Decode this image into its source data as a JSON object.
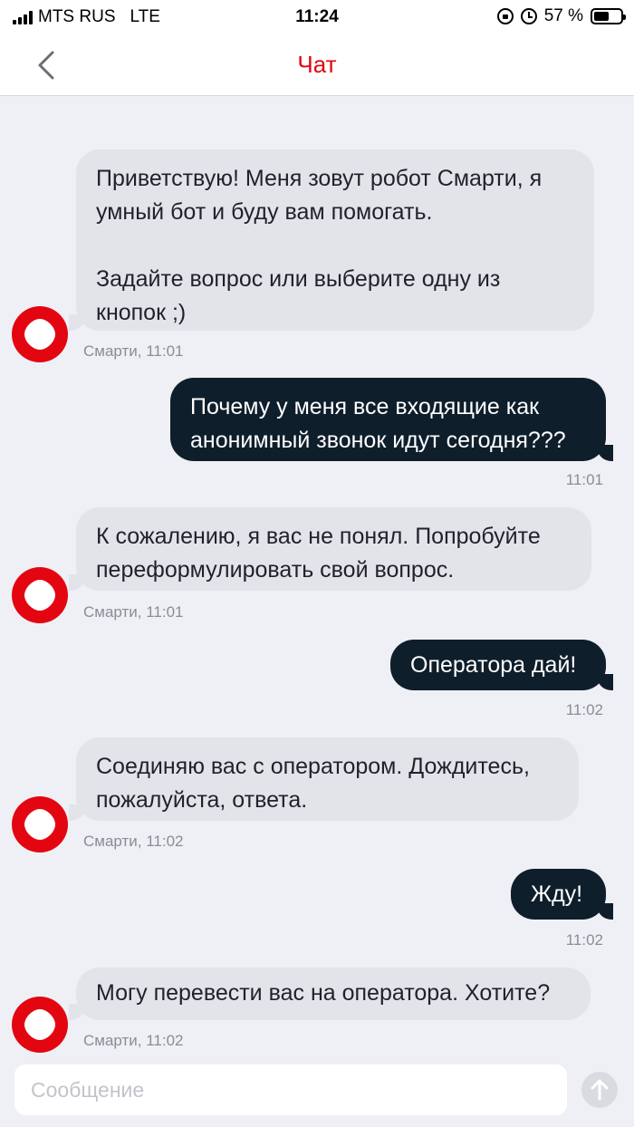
{
  "status_bar": {
    "carrier": "MTS RUS",
    "network": "LTE",
    "time": "11:24",
    "battery_percent": "57 %",
    "battery_level": 0.57
  },
  "header": {
    "title": "Чат",
    "accent_color": "#e30611"
  },
  "messages": [
    {
      "from": "bot",
      "text": "Приветствую! Меня зовут робот Смарти, я\nумный бот и буду вам помогать.\n\nЗадайте вопрос или выберите одну из\nкнопок ;)",
      "meta": "Смарти, 11:01"
    },
    {
      "from": "user",
      "text": "Почему у меня все входящие как\nанонимный звонок идут сегодня???",
      "meta": "11:01"
    },
    {
      "from": "bot",
      "text": "К сожалению, я вас не понял. Попробуйте\nпереформулировать свой вопрос.",
      "meta": "Смарти, 11:01"
    },
    {
      "from": "user",
      "text": "Оператора дай!",
      "meta": "11:02"
    },
    {
      "from": "bot",
      "text": "Соединяю вас с оператором. Дождитесь,\nпожалуйста, ответа.",
      "meta": "Смарти, 11:02"
    },
    {
      "from": "user",
      "text": "Жду!",
      "meta": "11:02"
    },
    {
      "from": "bot",
      "text": "Могу перевести вас на оператора. Хотите?",
      "meta": "Смарти, 11:02"
    }
  ],
  "composer": {
    "placeholder": "Сообщение",
    "send_icon": "arrow-up-icon"
  },
  "colors": {
    "background": "#eff0f5",
    "bot_bubble": "#e2e4ea",
    "user_bubble": "#0f1e2b",
    "avatar": "#e30611"
  }
}
